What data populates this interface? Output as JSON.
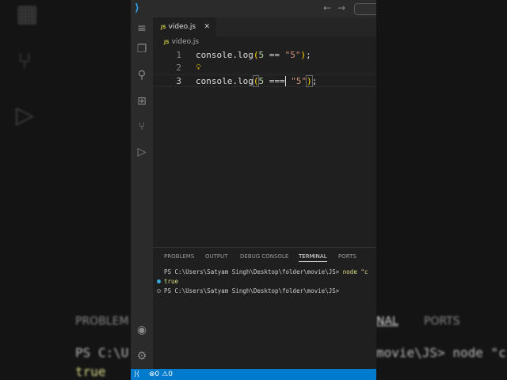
{
  "background": {
    "left_texts": [
      "PROBLEM",
      "PS C:\\U",
      "true"
    ],
    "right_texts": [
      "NAL",
      "PORTS",
      "movie\\JS> node \"c"
    ]
  },
  "titlebar": {
    "back": "←",
    "forward": "→"
  },
  "editor": {
    "tab_label": "video.js",
    "tab_icon": "JS",
    "close": "✕",
    "breadcrumb": "video.js",
    "lines": [
      {
        "number": "1",
        "code": "console.log(5 == \"5\");"
      },
      {
        "number": "2",
        "code": ""
      },
      {
        "number": "3",
        "code": "console.log(5 === \"5\");"
      }
    ]
  },
  "panel": {
    "tabs": [
      "PROBLEMS",
      "OUTPUT",
      "DEBUG CONSOLE",
      "TERMINAL",
      "PORTS"
    ],
    "active_tab": "TERMINAL",
    "terminal": [
      {
        "prompt": "PS C:\\Users\\Satyam Singh\\Desktop\\folder\\movie\\JS>",
        "command": "node \"c"
      },
      {
        "output": "true"
      },
      {
        "prompt": "PS C:\\Users\\Satyam Singh\\Desktop\\folder\\movie\\JS>"
      }
    ]
  },
  "status": {
    "errors": "0",
    "warnings": "0"
  },
  "colors": {
    "accent": "#007acc",
    "editor_bg": "#1f1f1f"
  }
}
